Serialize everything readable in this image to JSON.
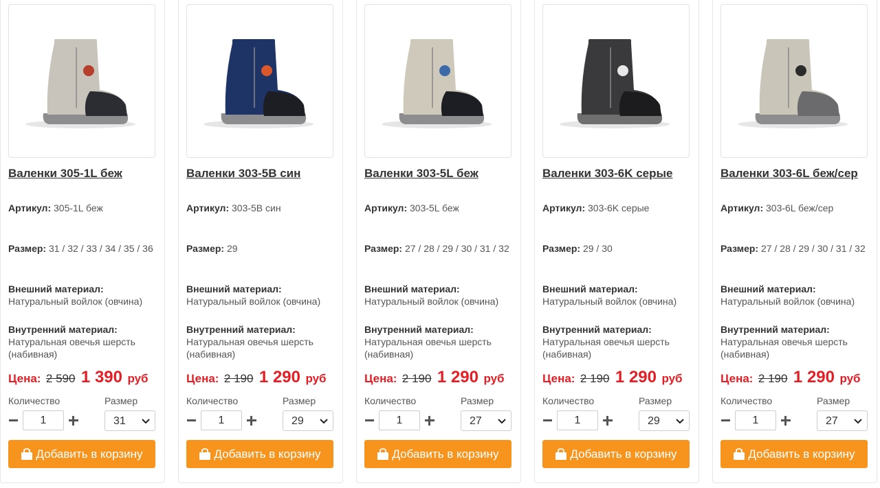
{
  "labels": {
    "article": "Артикул:",
    "size": "Размер:",
    "outer_material": "Внешний материал:",
    "inner_material": "Внутренний материал:",
    "price": "Цена:",
    "currency": "руб",
    "quantity": "Количество",
    "size_select": "Размер",
    "add_to_cart": "Добавить в корзину"
  },
  "products": [
    {
      "title": "Валенки 305-1L беж",
      "article": "305-1L беж",
      "sizes": "31 / 32 / 33 / 34 / 35 / 36",
      "outer_material": "Натуральный войлок (овчина)",
      "inner_material": "Натуральная овечья шерсть (набивная)",
      "old_price": "2 590",
      "new_price": "1 390",
      "quantity": "1",
      "selected_size": "31",
      "colors": {
        "felt": "#c8c4bb",
        "toe": "#2b2d33",
        "sole": "#8d8d8f",
        "accent": "#b53f2b"
      }
    },
    {
      "title": "Валенки 303-5B син",
      "article": "303-5B син",
      "sizes": "29",
      "outer_material": "Натуральный войлок (овчина)",
      "inner_material": "Натуральная овечья шерсть (набивная)",
      "old_price": "2 190",
      "new_price": "1 290",
      "quantity": "1",
      "selected_size": "29",
      "colors": {
        "felt": "#1f3466",
        "toe": "#1d1e24",
        "sole": "#8d8d8f",
        "accent": "#d9572b"
      }
    },
    {
      "title": "Валенки 303-5L беж",
      "article": "303-5L беж",
      "sizes": "27 / 28 / 29 / 30 / 31 / 32",
      "outer_material": "Натуральный войлок (овчина)",
      "inner_material": "Натуральная овечья шерсть (набивная)",
      "old_price": "2 190",
      "new_price": "1 290",
      "quantity": "1",
      "selected_size": "27",
      "colors": {
        "felt": "#cfc9bb",
        "toe": "#1d1e24",
        "sole": "#8d8d8f",
        "accent": "#3d6aa8"
      }
    },
    {
      "title": "Валенки 303-6K серые",
      "article": "303-6K серые",
      "sizes": "29 / 30",
      "outer_material": "Натуральный войлок (овчина)",
      "inner_material": "Натуральная овечья шерсть (набивная)",
      "old_price": "2 190",
      "new_price": "1 290",
      "quantity": "1",
      "selected_size": "29",
      "colors": {
        "felt": "#3a3a3c",
        "toe": "#1c1c1e",
        "sole": "#6f6f70",
        "accent": "#e8e8e8"
      }
    },
    {
      "title": "Валенки 303-6L беж/сер",
      "article": "303-6L беж/сер",
      "sizes": "27 / 28 / 29 / 30 / 31 / 32",
      "outer_material": "Натуральный войлок (овчина)",
      "inner_material": "Натуральная овечья шерсть (набивная)",
      "old_price": "2 190",
      "new_price": "1 290",
      "quantity": "1",
      "selected_size": "27",
      "colors": {
        "felt": "#c9c5b8",
        "toe": "#6b6b6d",
        "sole": "#8d8d8f",
        "accent": "#2b2b2b"
      }
    }
  ]
}
